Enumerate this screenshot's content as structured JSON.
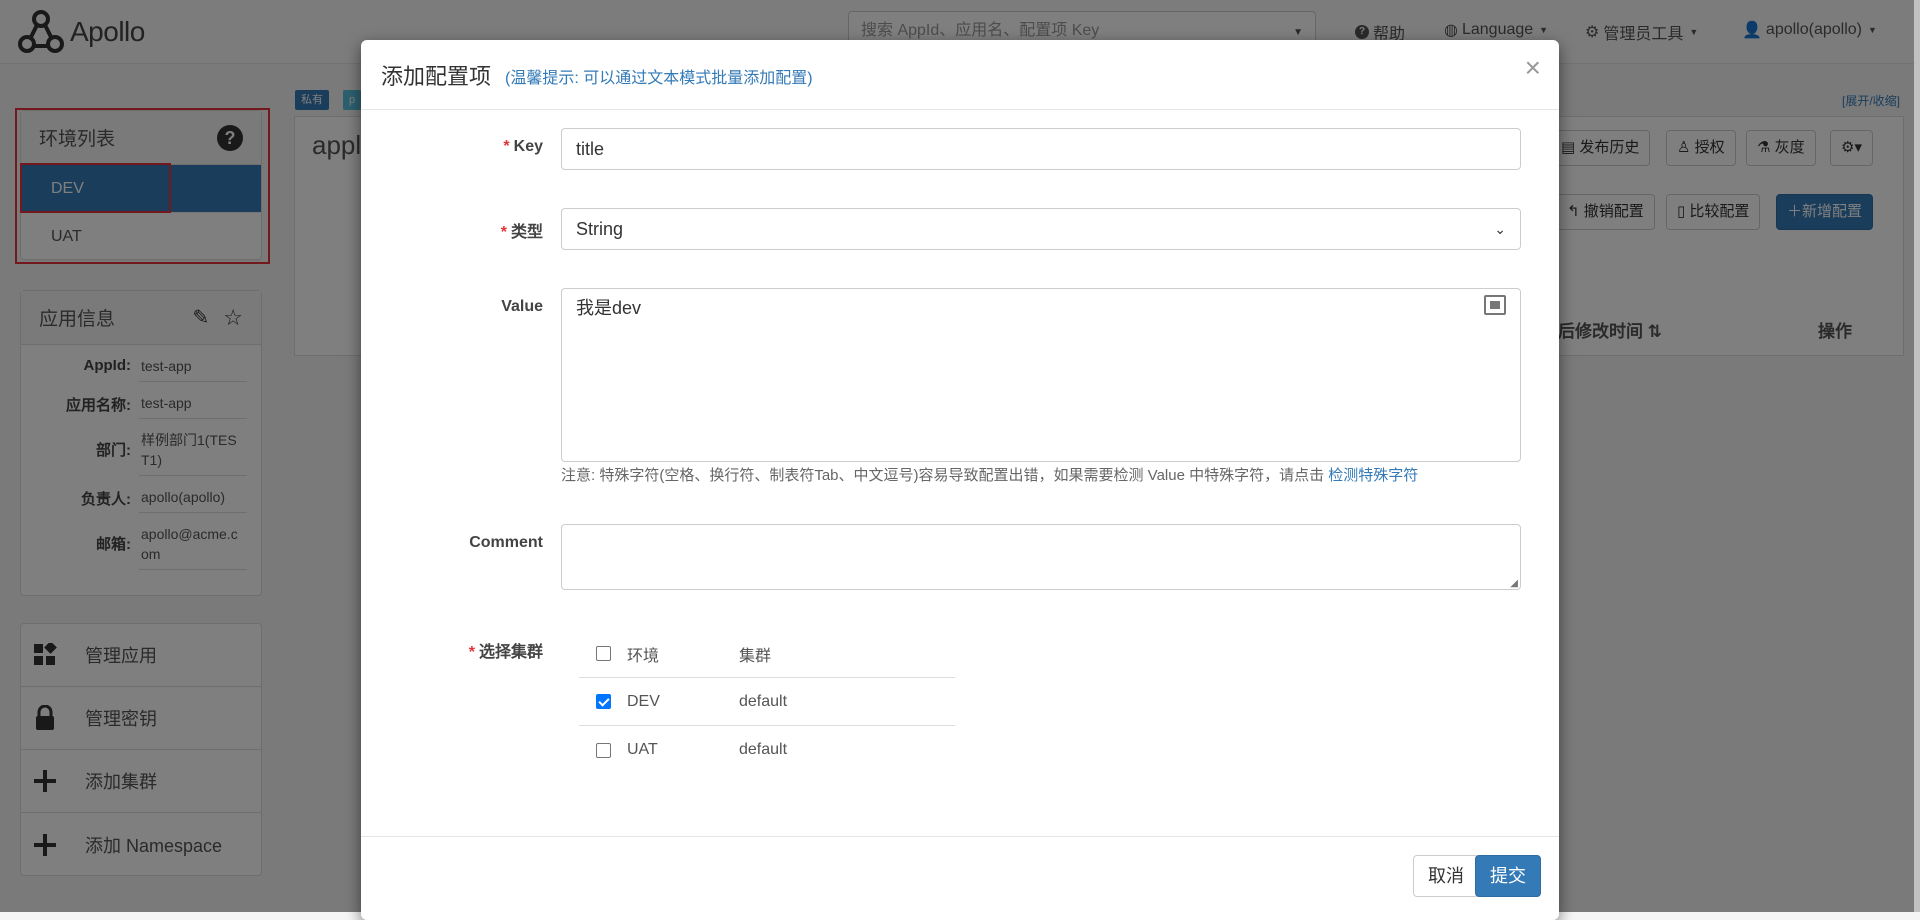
{
  "header": {
    "logo_text": "Apollo",
    "search_placeholder": "搜索 AppId、应用名、配置项 Key",
    "nav": {
      "help": "帮助",
      "language": "Language",
      "admin_tools": "管理员工具",
      "user": "apollo(apollo)"
    }
  },
  "env_panel": {
    "title": "环境列表",
    "items": [
      {
        "label": "DEV",
        "active": true
      },
      {
        "label": "UAT",
        "active": false
      }
    ]
  },
  "app_info": {
    "title": "应用信息",
    "rows": [
      {
        "key": "AppId:",
        "value": "test-app"
      },
      {
        "key": "应用名称:",
        "value": "test-app"
      },
      {
        "key": "部门:",
        "value": "样例部门1(TEST1)"
      },
      {
        "key": "负责人:",
        "value": "apollo(apollo)"
      },
      {
        "key": "邮箱:",
        "value": "apollo@acme.com"
      }
    ]
  },
  "side_menu": {
    "items": [
      {
        "label": "管理应用",
        "icon": "dashboard-icon"
      },
      {
        "label": "管理密钥",
        "icon": "lock-icon"
      },
      {
        "label": "添加集群",
        "icon": "plus-icon"
      },
      {
        "label": "添加 Namespace",
        "icon": "plus-icon"
      }
    ]
  },
  "background": {
    "tag_private": "私有",
    "tag_p": "p",
    "namespace_title": "appl",
    "expand_collapse": "[展开/收缩]",
    "buttons": {
      "release_history": "发布历史",
      "authorize": "授权",
      "gray": "灰度",
      "revoke": "撤销配置",
      "compare": "比较配置",
      "add_config": "新增配置"
    },
    "table": {
      "last_modified": "后修改时间",
      "actions": "操作"
    }
  },
  "modal": {
    "title": "添加配置项",
    "hint": "(温馨提示: 可以通过文本模式批量添加配置)",
    "close": "×",
    "fields": {
      "key_label": "Key",
      "key_value": "title",
      "type_label": "类型",
      "type_value": "String",
      "value_label": "Value",
      "value_value": "我是dev",
      "note_text": "注意: 特殊字符(空格、换行符、制表符Tab、中文逗号)容易导致配置出错，如果需要检测 Value 中特殊字符，请点击 ",
      "note_link": "检测特殊字符",
      "comment_label": "Comment",
      "comment_value": "",
      "cluster_label": "选择集群"
    },
    "cluster_table": {
      "header": {
        "env": "环境",
        "cluster": "集群"
      },
      "rows": [
        {
          "env": "DEV",
          "cluster": "default",
          "checked": true
        },
        {
          "env": "UAT",
          "cluster": "default",
          "checked": false
        }
      ]
    },
    "footer": {
      "cancel": "取消",
      "submit": "提交"
    }
  }
}
